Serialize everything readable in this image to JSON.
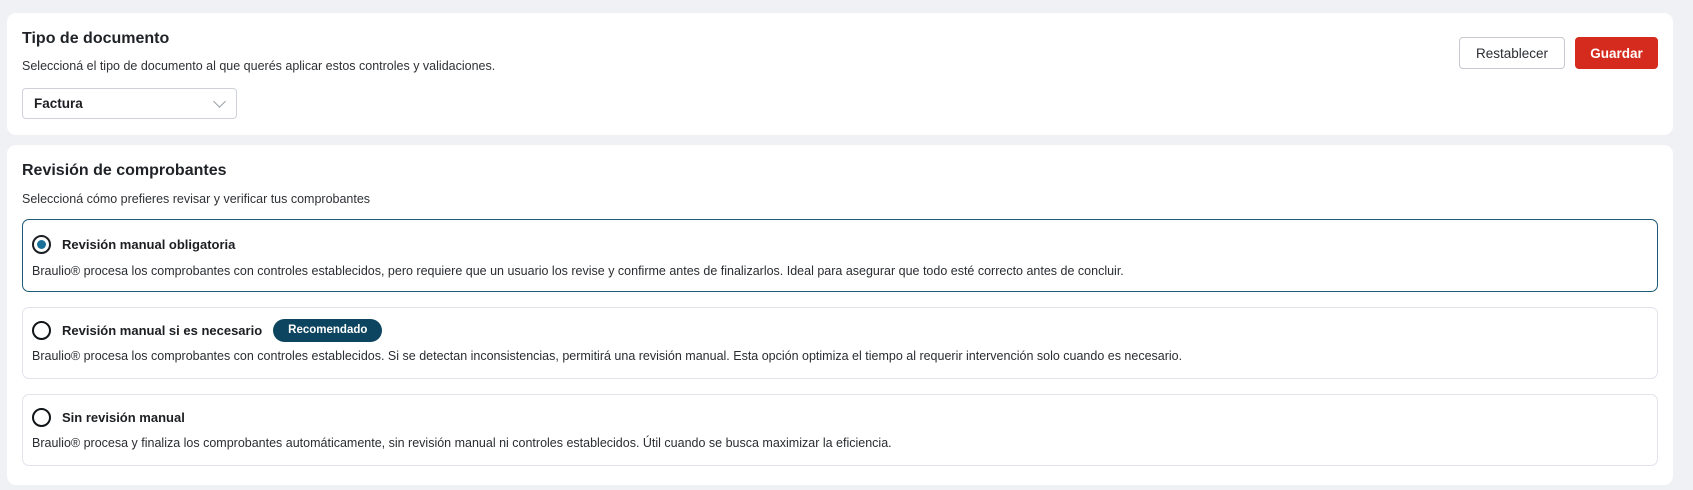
{
  "document_type": {
    "title": "Tipo de documento",
    "subtitle": "Seleccioná el tipo de documento al que querés aplicar estos controles y validaciones.",
    "select_value": "Factura",
    "reset_label": "Restablecer",
    "save_label": "Guardar"
  },
  "review": {
    "title": "Revisión de comprobantes",
    "subtitle": "Seleccioná cómo prefieres revisar y verificar tus comprobantes",
    "options": [
      {
        "label": "Revisión manual obligatoria",
        "description": "Braulio® procesa los comprobantes con controles establecidos, pero requiere que un usuario los revise y confirme antes de finalizarlos. Ideal para asegurar que todo esté correcto antes de concluir.",
        "selected": true
      },
      {
        "label": "Revisión manual si es necesario",
        "badge": "Recomendado",
        "description": "Braulio® procesa los comprobantes con controles establecidos. Si se detectan inconsistencias, permitirá una revisión manual. Esta opción optimiza el tiempo al requerir intervención solo cuando es necesario.",
        "selected": false
      },
      {
        "label": "Sin revisión manual",
        "description": "Braulio® procesa y finaliza los comprobantes automáticamente, sin revisión manual ni controles establecidos. Útil cuando se busca maximizar la eficiencia.",
        "selected": false
      }
    ]
  },
  "colors": {
    "save_button": "#d52a1e",
    "badge": "#0d4560",
    "selected_border": "#1d5a75",
    "radio_dot": "#19719a"
  },
  "icons": {
    "select": "chevron-down-icon"
  }
}
